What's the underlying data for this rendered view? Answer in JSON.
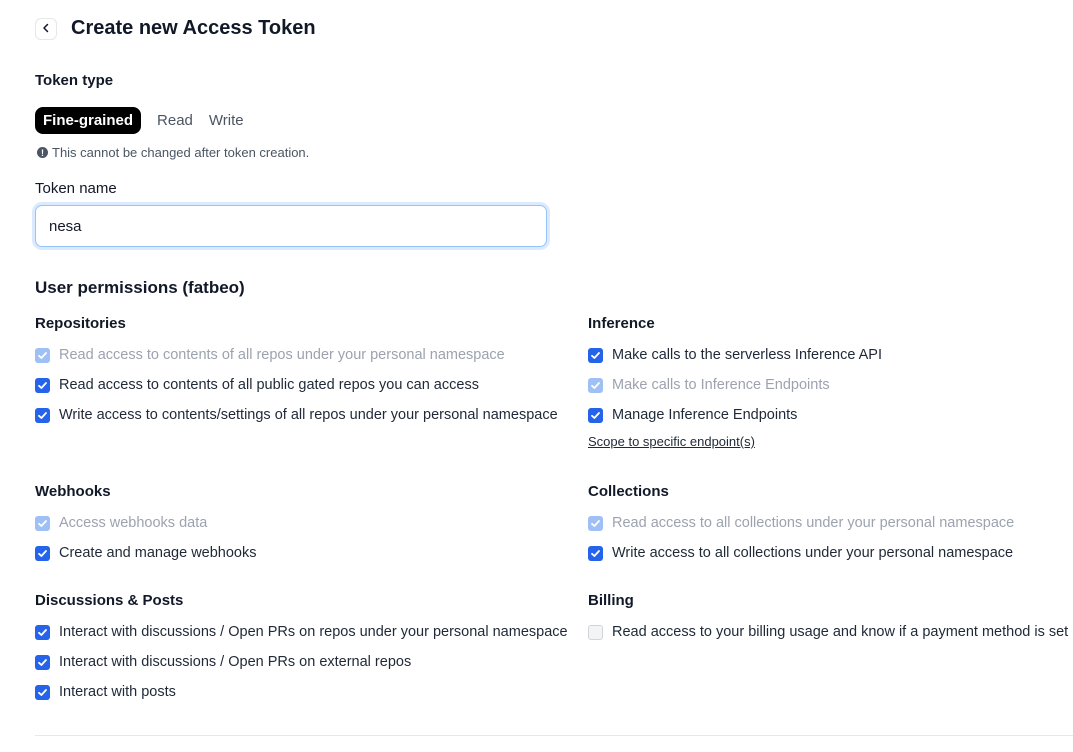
{
  "header": {
    "title": "Create new Access Token"
  },
  "token_type": {
    "label": "Token type",
    "tabs": [
      {
        "label": "Fine-grained",
        "active": true
      },
      {
        "label": "Read",
        "active": false
      },
      {
        "label": "Write",
        "active": false
      }
    ],
    "note": "This cannot be changed after token creation."
  },
  "token_name": {
    "label": "Token name",
    "value": "nesa"
  },
  "permissions": {
    "title": "User permissions (fatbeo)",
    "repositories": {
      "title": "Repositories",
      "items": [
        {
          "label": "Read access to contents of all repos under your personal namespace",
          "checked": true,
          "disabled": true
        },
        {
          "label": "Read access to contents of all public gated repos you can access",
          "checked": true,
          "disabled": false
        },
        {
          "label": "Write access to contents/settings of all repos under your personal namespace",
          "checked": true,
          "disabled": false
        }
      ]
    },
    "inference": {
      "title": "Inference",
      "items": [
        {
          "label": "Make calls to the serverless Inference API",
          "checked": true,
          "disabled": false
        },
        {
          "label": "Make calls to Inference Endpoints",
          "checked": true,
          "disabled": true
        },
        {
          "label": "Manage Inference Endpoints",
          "checked": true,
          "disabled": false
        }
      ],
      "link": "Scope to specific endpoint(s)"
    },
    "webhooks": {
      "title": "Webhooks",
      "items": [
        {
          "label": "Access webhooks data",
          "checked": true,
          "disabled": true
        },
        {
          "label": "Create and manage webhooks",
          "checked": true,
          "disabled": false
        }
      ]
    },
    "collections": {
      "title": "Collections",
      "items": [
        {
          "label": "Read access to all collections under your personal namespace",
          "checked": true,
          "disabled": true
        },
        {
          "label": "Write access to all collections under your personal namespace",
          "checked": true,
          "disabled": false
        }
      ]
    },
    "discussions": {
      "title": "Discussions & Posts",
      "items": [
        {
          "label": "Interact with discussions / Open PRs on repos under your personal namespace",
          "checked": true,
          "disabled": false
        },
        {
          "label": "Interact with discussions / Open PRs on external repos",
          "checked": true,
          "disabled": false
        },
        {
          "label": "Interact with posts",
          "checked": true,
          "disabled": false
        }
      ]
    },
    "billing": {
      "title": "Billing",
      "items": [
        {
          "label": "Read access to your billing usage and know if a payment method is set",
          "checked": false,
          "disabled": false
        }
      ]
    }
  },
  "colors": {
    "accent": "#2563eb",
    "accent_dim": "#9ec0f5",
    "focus_ring": "#93c5fd"
  }
}
